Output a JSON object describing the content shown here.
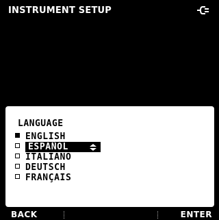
{
  "header": {
    "title": "INSTRUMENT SETUP",
    "power_icon": "power-plug-icon"
  },
  "panel": {
    "title": "LANGUAGE",
    "selected_index": 0,
    "highlight_index": 1,
    "options": [
      {
        "label": "ENGLISH"
      },
      {
        "label": "ESPAÑOL"
      },
      {
        "label": "ITALIANO"
      },
      {
        "label": "DEUTSCH"
      },
      {
        "label": "FRANÇAIS"
      }
    ]
  },
  "footer": {
    "back_label": "BACK",
    "enter_label": "ENTER"
  },
  "colors": {
    "background": "#000000",
    "panel": "#ffffff",
    "text_light": "#ffffff",
    "text_dark": "#000000"
  }
}
